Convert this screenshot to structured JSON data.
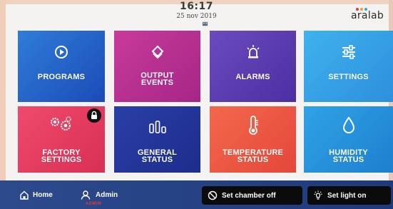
{
  "header": {
    "time": "16:17",
    "date": "25 nov 2019",
    "logo_text": "aralab",
    "usb_icon": "usb-icon"
  },
  "tiles": [
    {
      "label_line1": "PROGRAMS",
      "label_line2": "",
      "icon": "play-circle-icon",
      "color": "#2f7dd8"
    },
    {
      "label_line1": "OUTPUT",
      "label_line2": "EVENTS",
      "icon": "layers-icon",
      "color": "#c83a9a"
    },
    {
      "label_line1": "ALARMS",
      "label_line2": "",
      "icon": "siren-icon",
      "color": "#6b4bbd"
    },
    {
      "label_line1": "SETTINGS",
      "label_line2": "",
      "icon": "sliders-icon",
      "color": "#3fb2ee"
    },
    {
      "label_line1": "FACTORY",
      "label_line2": "SETTINGS",
      "icon": "gears-icon",
      "color": "#ef4a6b",
      "locked": true
    },
    {
      "label_line1": "GENERAL",
      "label_line2": "STATUS",
      "icon": "bar-chart-icon",
      "color": "#2a3fa6"
    },
    {
      "label_line1": "TEMPERATURE",
      "label_line2": "STATUS",
      "icon": "thermometer-icon",
      "color": "#f3684c"
    },
    {
      "label_line1": "HUMIDITY",
      "label_line2": "STATUS",
      "icon": "droplet-icon",
      "color": "#2fa3e6"
    }
  ],
  "footer": {
    "home_label": "Home",
    "admin_label": "Admin",
    "admin_role": "ADMIN",
    "chamber_button": "Set chamber off",
    "light_button": "Set light on",
    "background": "#2c4a8c"
  }
}
